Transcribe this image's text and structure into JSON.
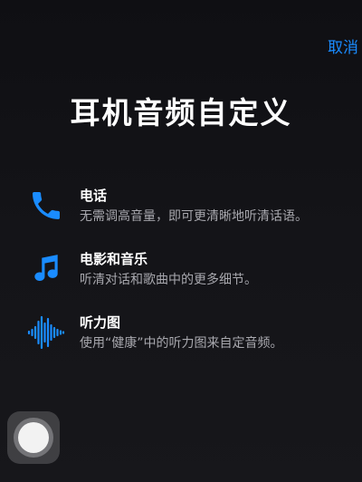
{
  "nav": {
    "cancel_label": "取消"
  },
  "title": "耳机音频自定义",
  "features": [
    {
      "icon": "phone-icon",
      "title": "电话",
      "description": "无需调高音量，即可更清晰地听清话语。"
    },
    {
      "icon": "music-note-icon",
      "title": "电影和音乐",
      "description": "听清对话和歌曲中的更多细节。"
    },
    {
      "icon": "audiogram-waveform-icon",
      "title": "听力图",
      "description": "使用“健康”中的听力图来自定音频。"
    }
  ],
  "colors": {
    "accent": "#1a8cff",
    "background": "#141418",
    "secondary_text": "#a8a8ae"
  },
  "assistive_touch": {
    "icon": "assistive-touch-icon"
  }
}
